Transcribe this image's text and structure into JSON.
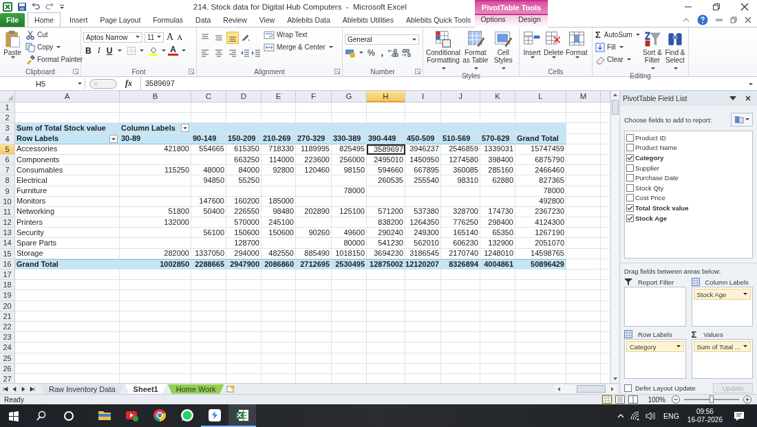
{
  "title_bar": {
    "title": "214. Stock data for Digital Hub Computers  -  Microsoft Excel",
    "context_group": "PivotTable Tools"
  },
  "ribbon_tabs": [
    {
      "label": "File",
      "kind": "file",
      "selected": false
    },
    {
      "label": "Home",
      "kind": "normal",
      "selected": true
    },
    {
      "label": "Insert",
      "kind": "normal",
      "selected": false
    },
    {
      "label": "Page Layout",
      "kind": "normal",
      "selected": false
    },
    {
      "label": "Formulas",
      "kind": "normal",
      "selected": false
    },
    {
      "label": "Data",
      "kind": "normal",
      "selected": false
    },
    {
      "label": "Review",
      "kind": "normal",
      "selected": false
    },
    {
      "label": "View",
      "kind": "normal",
      "selected": false
    },
    {
      "label": "Ablebits Data",
      "kind": "normal",
      "selected": false
    },
    {
      "label": "Ablebits Utilities",
      "kind": "normal",
      "selected": false
    },
    {
      "label": "Ablebits Quick Tools",
      "kind": "normal",
      "selected": false
    },
    {
      "label": "Options",
      "kind": "context",
      "selected": false
    },
    {
      "label": "Design",
      "kind": "context",
      "selected": false
    }
  ],
  "clipboard": {
    "label": "Clipboard",
    "paste": "Paste",
    "cut": "Cut",
    "copy": "Copy",
    "painter": "Format Painter"
  },
  "font": {
    "label": "Font",
    "name": "Aptos Narrow",
    "size": "11",
    "grow": "A",
    "shrink": "A",
    "bold": "B",
    "italic": "I",
    "underline": "U",
    "color_letter": "A"
  },
  "alignment": {
    "label": "Alignment",
    "vertical_buttons": [
      {
        "selected": false
      },
      {
        "selected": false
      },
      {
        "selected": true
      }
    ],
    "wrap": "Wrap Text",
    "merge": "Merge & Center"
  },
  "number": {
    "label": "Number",
    "format": "General",
    "percent": "%",
    "comma": ","
  },
  "styles": {
    "label": "Styles",
    "buttons": [
      "Conditional Formatting",
      "Format as Table",
      "Cell Styles"
    ]
  },
  "cells": {
    "label": "Cells",
    "buttons": [
      "Insert",
      "Delete",
      "Format"
    ]
  },
  "editing": {
    "label": "Editing",
    "sigma": "Σ",
    "autosum": "AutoSum",
    "fill": "Fill",
    "clear": "Clear",
    "sort": "Sort & Filter",
    "find": "Find & Select"
  },
  "formula_bar": {
    "name_box": "H5",
    "fx": "fx",
    "value": "3589697"
  },
  "sheet": {
    "columns": [
      {
        "letter": "A",
        "selected": false
      },
      {
        "letter": "B",
        "selected": false
      },
      {
        "letter": "C",
        "selected": false
      },
      {
        "letter": "D",
        "selected": false
      },
      {
        "letter": "E",
        "selected": false
      },
      {
        "letter": "F",
        "selected": false
      },
      {
        "letter": "G",
        "selected": false
      },
      {
        "letter": "H",
        "selected": true
      },
      {
        "letter": "I",
        "selected": false
      },
      {
        "letter": "J",
        "selected": false
      },
      {
        "letter": "K",
        "selected": false
      },
      {
        "letter": "L",
        "selected": false
      },
      {
        "letter": "M",
        "selected": false
      }
    ],
    "rows": [
      {
        "number": "1",
        "selected": false,
        "kind": "empty"
      },
      {
        "number": "2",
        "selected": false,
        "kind": "empty"
      },
      {
        "number": "3",
        "selected": false,
        "kind": "pivot_title",
        "cells": [
          "Sum of Total Stock value",
          {
            "text": "Column Labels",
            "dropdown": true
          },
          null,
          null,
          null,
          null,
          null,
          null,
          null,
          null,
          null,
          null
        ]
      },
      {
        "number": "4",
        "selected": false,
        "kind": "pivot_header",
        "cells": [
          {
            "text": "Row Labels",
            "dropdown": true
          },
          "30-89",
          "90-149",
          "150-209",
          "210-269",
          "270-329",
          "330-389",
          "390-449",
          "450-509",
          "510-569",
          "570-629",
          "Grand Total"
        ]
      },
      {
        "number": "5",
        "selected": true,
        "kind": "data",
        "cells": [
          "Accessories",
          "421800",
          "554665",
          "615350",
          "718330",
          "1189995",
          "825495",
          "3589697",
          "3946237",
          "2546859",
          "1339031",
          "15747459"
        ]
      },
      {
        "number": "6",
        "selected": false,
        "kind": "data",
        "cells": [
          "Components",
          null,
          null,
          "663250",
          "114000",
          "223600",
          "256000",
          "2495010",
          "1450950",
          "1274580",
          "398400",
          "6875790"
        ]
      },
      {
        "number": "7",
        "selected": false,
        "kind": "data",
        "cells": [
          "Consumables",
          "115250",
          "48000",
          "84000",
          "92800",
          "120460",
          "98150",
          "594660",
          "667895",
          "360085",
          "285160",
          "2466460"
        ]
      },
      {
        "number": "8",
        "selected": false,
        "kind": "data",
        "cells": [
          "Electrical",
          null,
          "94850",
          "55250",
          null,
          null,
          null,
          "260535",
          "255540",
          "98310",
          "62880",
          "827365"
        ]
      },
      {
        "number": "9",
        "selected": false,
        "kind": "data",
        "cells": [
          "Furniture",
          null,
          null,
          null,
          null,
          null,
          "78000",
          null,
          null,
          null,
          null,
          "78000"
        ]
      },
      {
        "number": "10",
        "selected": false,
        "kind": "data",
        "cells": [
          "Monitors",
          null,
          "147600",
          "160200",
          "185000",
          null,
          null,
          null,
          null,
          null,
          null,
          "492800"
        ]
      },
      {
        "number": "11",
        "selected": false,
        "kind": "data",
        "cells": [
          "Networking",
          "51800",
          "50400",
          "226550",
          "98480",
          "202890",
          "125100",
          "571200",
          "537380",
          "328700",
          "174730",
          "2367230"
        ]
      },
      {
        "number": "12",
        "selected": false,
        "kind": "data",
        "cells": [
          "Printers",
          "132000",
          null,
          "570000",
          "245100",
          null,
          null,
          "838200",
          "1264350",
          "776250",
          "298400",
          "4124300"
        ]
      },
      {
        "number": "13",
        "selected": false,
        "kind": "data",
        "cells": [
          "Security",
          null,
          "56100",
          "150600",
          "150600",
          "90260",
          "49600",
          "290240",
          "249300",
          "165140",
          "65350",
          "1267190"
        ]
      },
      {
        "number": "14",
        "selected": false,
        "kind": "data",
        "cells": [
          "Spare Parts",
          null,
          null,
          "128700",
          null,
          null,
          "80000",
          "541230",
          "562010",
          "606230",
          "132900",
          "2051070"
        ]
      },
      {
        "number": "15",
        "selected": false,
        "kind": "data",
        "cells": [
          "Storage",
          "282000",
          "1337050",
          "294000",
          "482550",
          "885490",
          "1018150",
          "3694230",
          "3186545",
          "2170740",
          "1248010",
          "14598765"
        ]
      },
      {
        "number": "16",
        "selected": false,
        "kind": "total",
        "cells": [
          "Grand Total",
          "1002850",
          "2288665",
          "2947900",
          "2086860",
          "2712695",
          "2530495",
          "12875002",
          "12120207",
          "8326894",
          "4004861",
          "50896429"
        ]
      },
      {
        "number": "17",
        "selected": false,
        "kind": "empty"
      },
      {
        "number": "18",
        "selected": false,
        "kind": "empty"
      },
      {
        "number": "19",
        "selected": false,
        "kind": "empty"
      },
      {
        "number": "20",
        "selected": false,
        "kind": "empty"
      },
      {
        "number": "21",
        "selected": false,
        "kind": "empty"
      },
      {
        "number": "22",
        "selected": false,
        "kind": "empty"
      },
      {
        "number": "23",
        "selected": false,
        "kind": "empty"
      },
      {
        "number": "24",
        "selected": false,
        "kind": "empty"
      },
      {
        "number": "25",
        "selected": false,
        "kind": "empty"
      },
      {
        "number": "26",
        "selected": false,
        "kind": "empty"
      },
      {
        "number": "27",
        "selected": false,
        "kind": "empty"
      }
    ]
  },
  "sheet_tabs": [
    {
      "label": "Raw Inventory Data",
      "selected": false
    },
    {
      "label": "Sheet1",
      "selected": true
    },
    {
      "label": "Home Work",
      "selected": false,
      "color": "#92d050"
    }
  ],
  "field_list": {
    "title": "PivotTable Field List",
    "prompt": "Choose fields to add to report:",
    "fields": [
      {
        "label": "Product ID",
        "checked": false
      },
      {
        "label": "Product Name",
        "checked": false
      },
      {
        "label": "Category",
        "checked": true
      },
      {
        "label": "Supplier",
        "checked": false
      },
      {
        "label": "Purchase Date",
        "checked": false
      },
      {
        "label": "Stock Qty",
        "checked": false
      },
      {
        "label": "Cost Price",
        "checked": false
      },
      {
        "label": "Total Stock value",
        "checked": true
      },
      {
        "label": "Stock Age",
        "checked": true
      }
    ],
    "areas_prompt": "Drag fields between areas below:",
    "areas": [
      {
        "kind": "filter",
        "label": "Report Filter"
      },
      {
        "kind": "columns",
        "label": "Column Labels",
        "fields": [
          "Stock Age"
        ]
      },
      {
        "kind": "rows",
        "label": "Row Labels",
        "fields": [
          "Category"
        ]
      },
      {
        "kind": "values",
        "label": "Values",
        "symbol": "Σ",
        "fields": [
          "Sum of Total ..."
        ]
      }
    ],
    "defer": {
      "label": "Defer Layout Update",
      "checked": false
    },
    "update": {
      "label": "Update",
      "disabled": true
    }
  },
  "status_bar": {
    "text": "Ready",
    "views": [
      {
        "selected": true
      },
      {
        "selected": false
      },
      {
        "selected": false
      }
    ],
    "zoom": "100%",
    "level": 0.5
  },
  "taskbar": {
    "apps": [
      {
        "running": false,
        "active": false
      },
      {
        "running": false,
        "active": false
      },
      {
        "running": false,
        "active": false
      },
      {
        "running": false,
        "active": false
      },
      {
        "running": true,
        "active": false
      },
      {
        "running": true,
        "active": true
      }
    ],
    "language": "ENG",
    "time": "09:56",
    "date": "16-07-2026"
  }
}
